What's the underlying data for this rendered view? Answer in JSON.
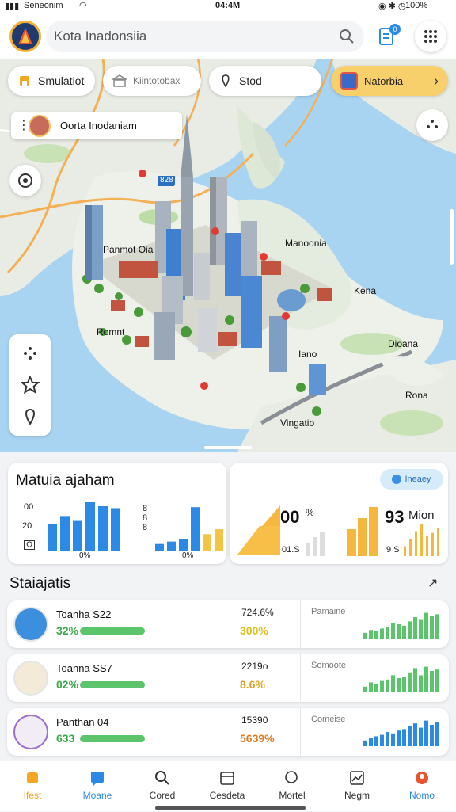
{
  "status": {
    "left": "Seneonim",
    "time": "04:4M",
    "battery": "100%"
  },
  "search": {
    "value": "Kota Inadonsiia"
  },
  "header": {
    "badge": "0"
  },
  "chips": [
    {
      "label": "Smulatiot",
      "icon": "building-icon"
    },
    {
      "label": "Kiintotobax",
      "icon": "bank-icon"
    },
    {
      "label": "Stod",
      "icon": "pin-icon"
    },
    {
      "label": "Natorbia",
      "icon": "city-badge-icon"
    }
  ],
  "map": {
    "city_label": "Oorta Inodaniam",
    "labels": [
      "Panmot Oia",
      "Manoonia",
      "Kena",
      "Romnt",
      "Dioana",
      "Iano",
      "Rona",
      "Vingatio"
    ],
    "route_sign": "828"
  },
  "cards": {
    "left_title": "Matuia ajaham",
    "left_axis": [
      "00",
      "20",
      "Ω"
    ],
    "left_pct1": "0%",
    "left_pct2": "0%",
    "right_chip": "Ineaey",
    "right_val1": "00",
    "right_val1_unit": "%",
    "right_val1_sub": "01.S",
    "right_val2": "93",
    "right_val2_unit": "Mion",
    "right_val2_sub": "9 S"
  },
  "chart_left_a": {
    "values": [
      0.55,
      0.72,
      0.62,
      1.0,
      0.92,
      0.88
    ]
  },
  "chart_left_b": {
    "values": [
      0.15,
      0.2,
      0.25,
      0.9,
      0.35,
      0.45
    ]
  },
  "chart_right_b": {
    "values": [
      0.3,
      0.5,
      0.75,
      0.95,
      0.6,
      0.7,
      0.85
    ]
  },
  "stats": {
    "title": "Staiajatis",
    "rows": [
      {
        "name": "Toanha S22",
        "pct": "32%",
        "value": "724.6%",
        "value_pct": "300%",
        "label": "Pamaine",
        "icon": "pencil-icon",
        "icon_bg": "#3b8fdc",
        "progress": 0.55,
        "spark": [
          0.2,
          0.3,
          0.25,
          0.35,
          0.4,
          0.55,
          0.5,
          0.45,
          0.6,
          0.75,
          0.65,
          0.9,
          0.8,
          0.85
        ]
      },
      {
        "name": "Toanna SS7",
        "pct": "02%",
        "value": "2219o",
        "value_pct": "8.6%",
        "label": "Somoote",
        "icon": "house-icon",
        "icon_bg": "#f4ead8",
        "progress": 0.55,
        "spark": [
          0.2,
          0.35,
          0.3,
          0.4,
          0.45,
          0.6,
          0.5,
          0.55,
          0.7,
          0.85,
          0.6,
          0.9,
          0.75,
          0.8
        ]
      },
      {
        "name": "Panthan 04",
        "pct": "633",
        "value": "15390",
        "value_pct": "5639%",
        "label": "Comeise",
        "icon": "temple-icon",
        "icon_bg": "#f1ecf6",
        "progress": 0.55,
        "spark": [
          0.2,
          0.3,
          0.35,
          0.4,
          0.5,
          0.45,
          0.55,
          0.6,
          0.7,
          0.8,
          0.65,
          0.9,
          0.75,
          0.85
        ]
      }
    ]
  },
  "nav": [
    {
      "label": "Ifest",
      "icon": "home-icon",
      "color": "#f5a623"
    },
    {
      "label": "Moane",
      "icon": "chat-icon",
      "color": "#2b8ae6"
    },
    {
      "label": "Cored",
      "icon": "search-icon",
      "color": "#333"
    },
    {
      "label": "Cesdeta",
      "icon": "calendar-icon",
      "color": "#333"
    },
    {
      "label": "Mortel",
      "icon": "magnify-icon",
      "color": "#333"
    },
    {
      "label": "Negm",
      "icon": "chart-icon",
      "color": "#333"
    },
    {
      "label": "Nomo",
      "icon": "profile-icon",
      "color": "#2b8ae6"
    }
  ],
  "colors": {
    "blue": "#2b8ae6",
    "orange": "#f5a623",
    "green": "#5cc56b",
    "yellow": "#f4c542"
  }
}
